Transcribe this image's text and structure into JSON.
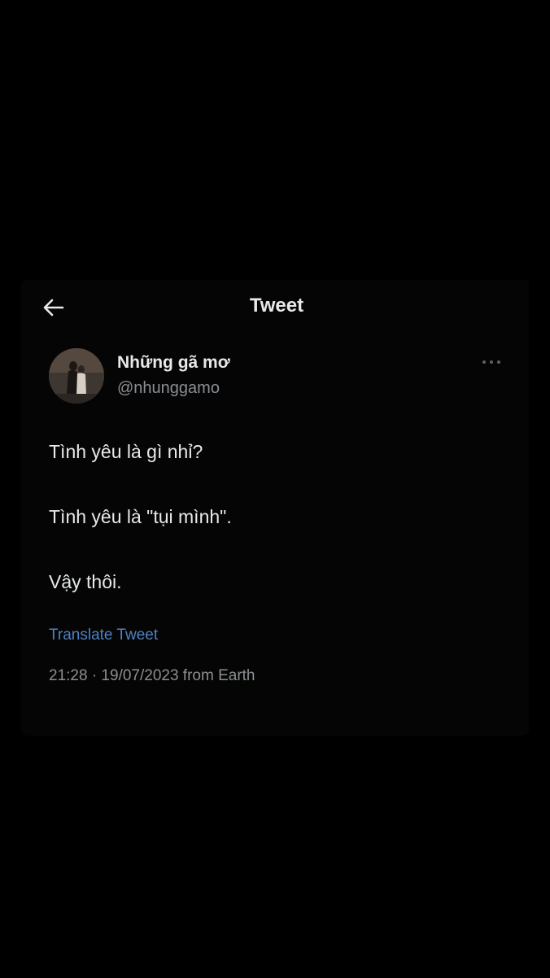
{
  "header": {
    "title": "Tweet",
    "back_icon": "arrow-left-icon"
  },
  "author": {
    "display_name": "Những gã mơ",
    "handle": "@nhunggamo",
    "more_icon": "more-horizontal-icon"
  },
  "tweet": {
    "lines": [
      "Tình yêu là gì nhỉ?",
      "Tình yêu là \"tụi mình\".",
      "Vậy thôi."
    ],
    "translate_label": "Translate Tweet",
    "meta": "21:28 · 19/07/2023 from Earth"
  },
  "colors": {
    "background": "#000000",
    "text": "#e7e9ea",
    "secondary_text": "#8b8f93",
    "link": "#4d82c4"
  }
}
